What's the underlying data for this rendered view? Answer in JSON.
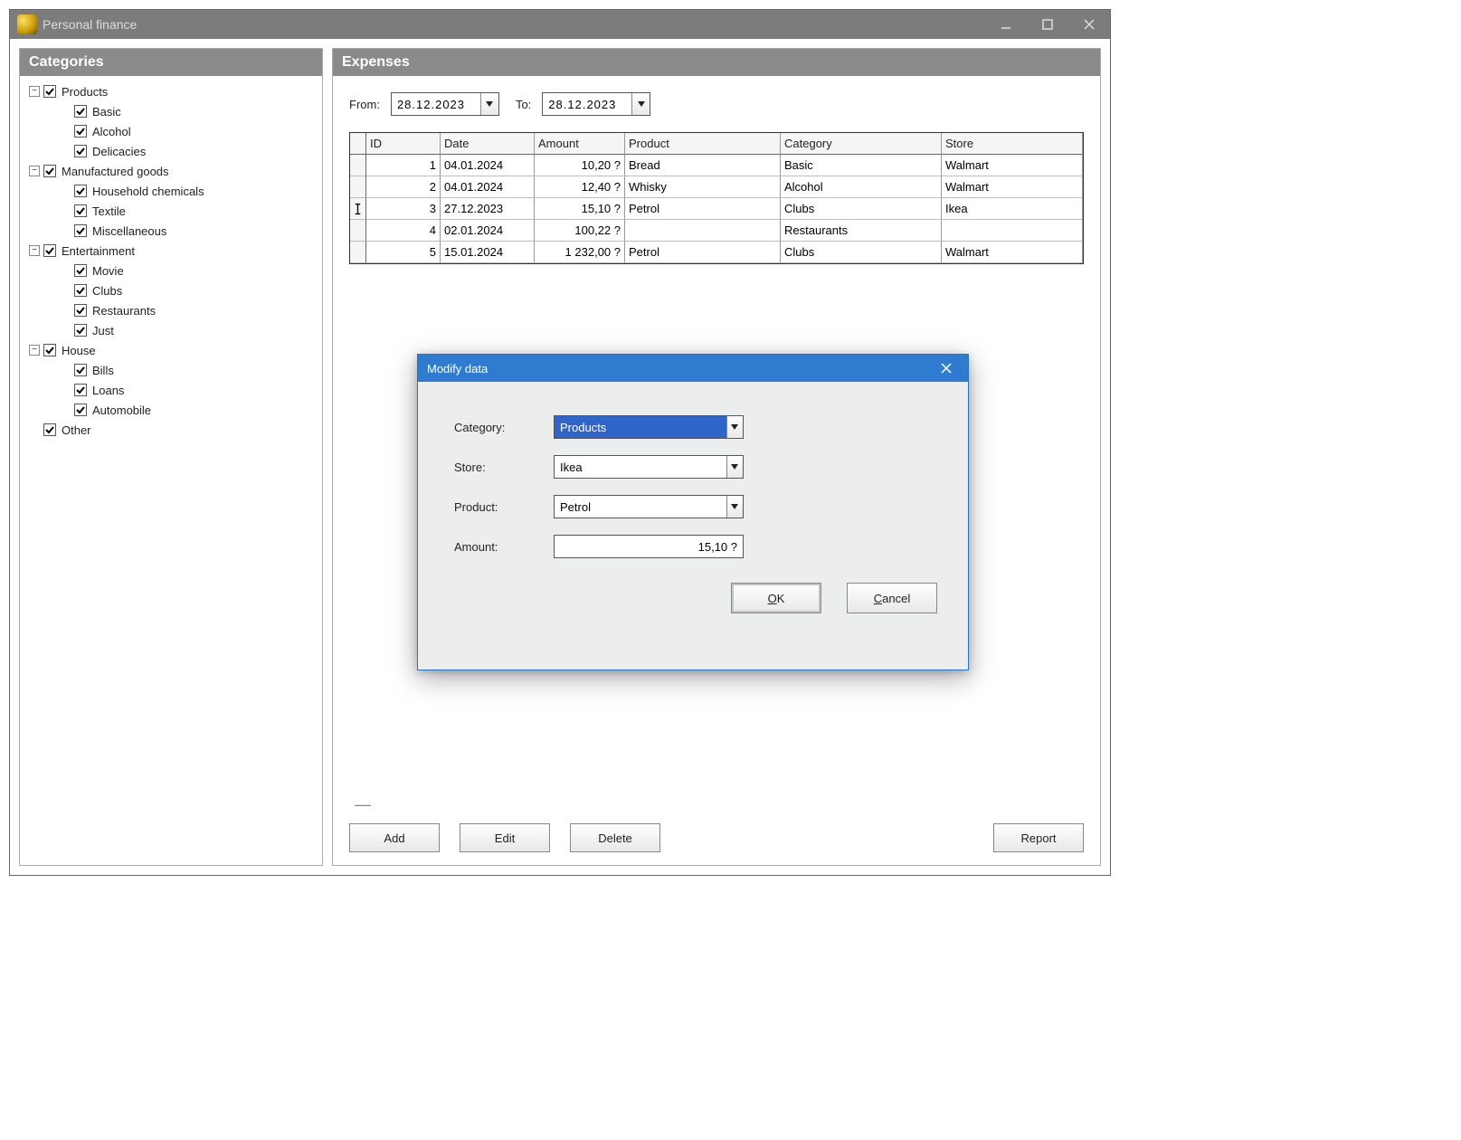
{
  "window": {
    "title": "Personal finance"
  },
  "panels": {
    "categories_title": "Categories",
    "expenses_title": "Expenses"
  },
  "tree": [
    {
      "level": 0,
      "toggle": "-",
      "checked": true,
      "label": "Products"
    },
    {
      "level": 1,
      "toggle": "",
      "checked": true,
      "label": "Basic"
    },
    {
      "level": 1,
      "toggle": "",
      "checked": true,
      "label": "Alcohol"
    },
    {
      "level": 1,
      "toggle": "",
      "checked": true,
      "label": "Delicacies"
    },
    {
      "level": 0,
      "toggle": "-",
      "checked": true,
      "label": "Manufactured goods"
    },
    {
      "level": 1,
      "toggle": "",
      "checked": true,
      "label": "Household chemicals"
    },
    {
      "level": 1,
      "toggle": "",
      "checked": true,
      "label": "Textile"
    },
    {
      "level": 1,
      "toggle": "",
      "checked": true,
      "label": "Miscellaneous"
    },
    {
      "level": 0,
      "toggle": "-",
      "checked": true,
      "label": "Entertainment"
    },
    {
      "level": 1,
      "toggle": "",
      "checked": true,
      "label": "Movie"
    },
    {
      "level": 1,
      "toggle": "",
      "checked": true,
      "label": "Clubs"
    },
    {
      "level": 1,
      "toggle": "",
      "checked": true,
      "label": "Restaurants"
    },
    {
      "level": 1,
      "toggle": "",
      "checked": true,
      "label": "Just"
    },
    {
      "level": 0,
      "toggle": "-",
      "checked": true,
      "label": "House"
    },
    {
      "level": 1,
      "toggle": "",
      "checked": true,
      "label": "Bills"
    },
    {
      "level": 1,
      "toggle": "",
      "checked": true,
      "label": "Loans"
    },
    {
      "level": 1,
      "toggle": "",
      "checked": true,
      "label": "Automobile"
    },
    {
      "level": 0,
      "toggle": "",
      "checked": true,
      "label": "Other"
    }
  ],
  "dates": {
    "from_label": "From:",
    "from_value": "28.12.2023",
    "to_label": "To:",
    "to_value": "28.12.2023"
  },
  "grid": {
    "headers": {
      "id": "ID",
      "date": "Date",
      "amount": "Amount",
      "product": "Product",
      "category": "Category",
      "store": "Store"
    },
    "rows": [
      {
        "marker": "",
        "id": "1",
        "date": "04.01.2024",
        "amount": "10,20 ?",
        "product": "Bread",
        "category": "Basic",
        "store": "Walmart"
      },
      {
        "marker": "",
        "id": "2",
        "date": "04.01.2024",
        "amount": "12,40 ?",
        "product": "Whisky",
        "category": "Alcohol",
        "store": "Walmart"
      },
      {
        "marker": "I",
        "id": "3",
        "date": "27.12.2023",
        "amount": "15,10 ?",
        "product": "Petrol",
        "category": "Clubs",
        "store": "Ikea"
      },
      {
        "marker": "",
        "id": "4",
        "date": "02.01.2024",
        "amount": "100,22 ?",
        "product": "",
        "category": "Restaurants",
        "store": ""
      },
      {
        "marker": "",
        "id": "5",
        "date": "15.01.2024",
        "amount": "1 232,00 ?",
        "product": "Petrol",
        "category": "Clubs",
        "store": "Walmart"
      }
    ]
  },
  "buttons": {
    "add": "Add",
    "edit": "Edit",
    "delete": "Delete",
    "report": "Report"
  },
  "dialog": {
    "title": "Modify data",
    "category_label": "Category:",
    "category_value": "Products",
    "store_label": "Store:",
    "store_value": "Ikea",
    "product_label": "Product:",
    "product_value": "Petrol",
    "amount_label": "Amount:",
    "amount_value": "15,10 ?",
    "ok": "OK",
    "cancel": "Cancel"
  }
}
